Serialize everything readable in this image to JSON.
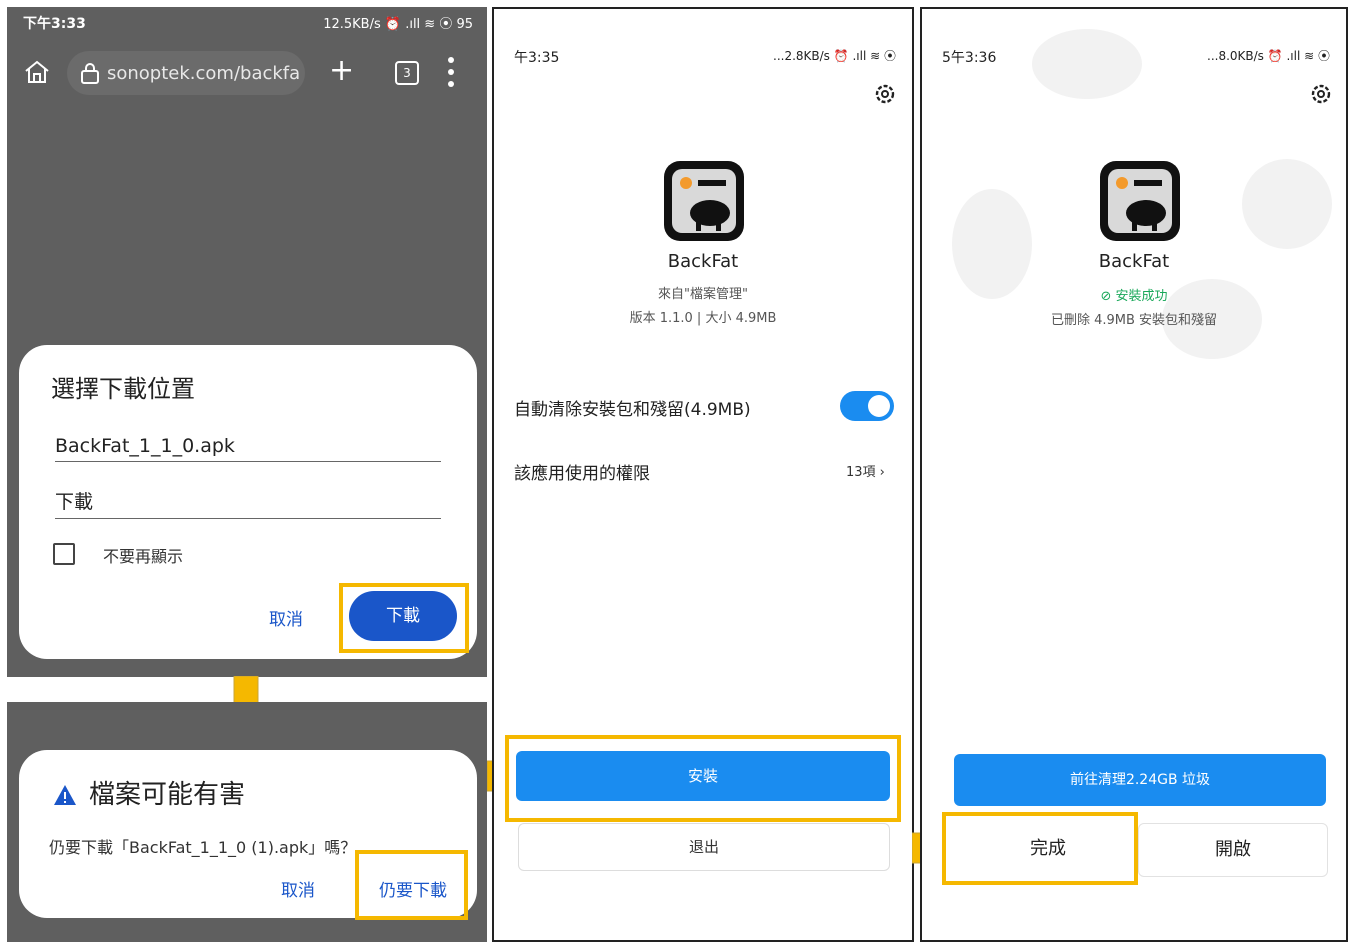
{
  "panel1": {
    "status_time": "下午3:33",
    "status_right": "12.5KB/s ⏰ .ıll ≋ ⦿ 95",
    "url": "sonoptek.com/backfa",
    "tab_count": "3",
    "dialog": {
      "title": "選擇下載位置",
      "filename": "BackFat_1_1_0.apk",
      "folder": "下載",
      "checkbox_label": "不要再顯示",
      "cancel": "取消",
      "download": "下載"
    }
  },
  "panel1b": {
    "title": "檔案可能有害",
    "question": "仍要下載「BackFat_1_1_0 (1).apk」嗎？",
    "cancel": "取消",
    "download_anyway": "仍要下載"
  },
  "panel2": {
    "status_time": "午3:35",
    "status_right": "...2.8KB/s ⏰ .ıll ≋ ⦿",
    "app_name": "BackFat",
    "source": "來自\"檔案管理\"",
    "version": "版本 1.1.0 | 大小 4.9MB",
    "auto_clean": "自動清除安裝包和殘留(4.9MB)",
    "permissions": "該應用使用的權限",
    "permissions_count": "13項 ›",
    "install": "安裝",
    "exit": "退出"
  },
  "panel3": {
    "status_time": "5午3:36",
    "status_right": "...8.0KB/s ⏰ .ıll ≋ ⦿",
    "app_name": "BackFat",
    "success": "安裝成功",
    "removed": "已刪除 4.9MB 安裝包和殘留",
    "clean_button": "前往清理2.24GB 垃圾",
    "done": "完成",
    "open": "開啟"
  },
  "colors": {
    "highlight": "#f5b800",
    "primary_blue": "#1a8cf0",
    "dialog_blue": "#1a56c9"
  }
}
